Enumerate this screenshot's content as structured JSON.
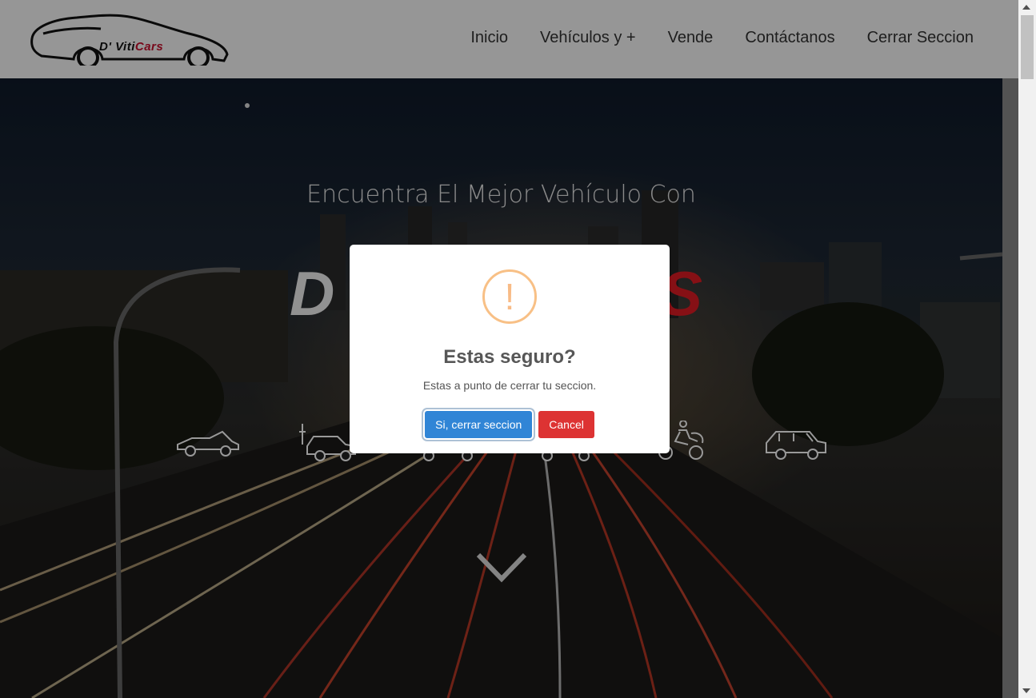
{
  "header": {
    "logo_prefix": "D'",
    "logo_main": "Viti",
    "logo_accent": "Cars",
    "nav": [
      {
        "label": "Inicio"
      },
      {
        "label": "Vehículos y +"
      },
      {
        "label": "Vende"
      },
      {
        "label": "Contáctanos"
      },
      {
        "label": "Cerrar Seccion"
      }
    ]
  },
  "hero": {
    "title": "Encuentra El Mejor Vehículo Con",
    "brand_left": "D",
    "brand_right": "S",
    "categories": [
      "convertible-icon",
      "electric-car-icon",
      "sedan-icon",
      "car-icon",
      "motorcycle-icon",
      "suv-icon"
    ]
  },
  "modal": {
    "icon": "!",
    "title": "Estas seguro?",
    "text": "Estas a punto de cerrar tu seccion.",
    "confirm_label": "Si, cerrar seccion",
    "cancel_label": "Cancel"
  },
  "colors": {
    "confirm": "#3085d6",
    "cancel": "#dd3333",
    "warning": "#f8bb86",
    "brand_red": "#c8102e"
  }
}
